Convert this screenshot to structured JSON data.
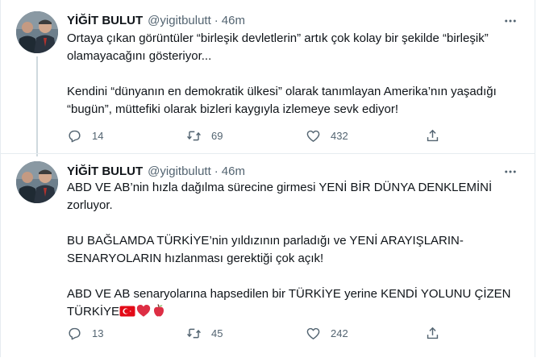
{
  "colors": {
    "text": "#0f1419",
    "secondary": "#536471",
    "border": "#e6ecf0",
    "thread_line": "#cfd9de"
  },
  "tweets": [
    {
      "author_name": "YİĞİT BULUT",
      "handle": "@yigitbulutt",
      "separator": "·",
      "time": "46m",
      "paragraphs": [
        "Ortaya çıkan görüntüler “birleşik devletlerin” artık çok kolay bir şekilde “birleşik” olamayacağını gösteriyor...",
        "Kendini “dünyanın en demokratik ülkesi” olarak tanımlayan Amerika’nın yaşadığı “bugün”, müttefiki olarak bizleri kaygıyla izlemeye sevk ediyor!"
      ],
      "stats": {
        "replies": "14",
        "retweets": "69",
        "likes": "432"
      }
    },
    {
      "author_name": "YİĞİT BULUT",
      "handle": "@yigitbulutt",
      "separator": "·",
      "time": "46m",
      "paragraphs": [
        "ABD VE AB’nin hızla dağılma sürecine girmesi YENİ BİR DÜNYA DENKLEMİNİ zorluyor.",
        "BU BAĞLAMDA TÜRKİYE’nin yıldızının parladığı ve YENİ ARAYIŞLARIN-SENARYOLARIN hızlanması gerektiği çok açık!",
        "ABD VE AB senaryolarına hapsedilen bir TÜRKİYE yerine KENDİ YOLUNU ÇİZEN TÜRKİYE"
      ],
      "emoji": [
        "turkey-flag-icon",
        "red-heart-icon",
        "red-apple-icon"
      ],
      "stats": {
        "replies": "13",
        "retweets": "45",
        "likes": "242"
      }
    }
  ]
}
